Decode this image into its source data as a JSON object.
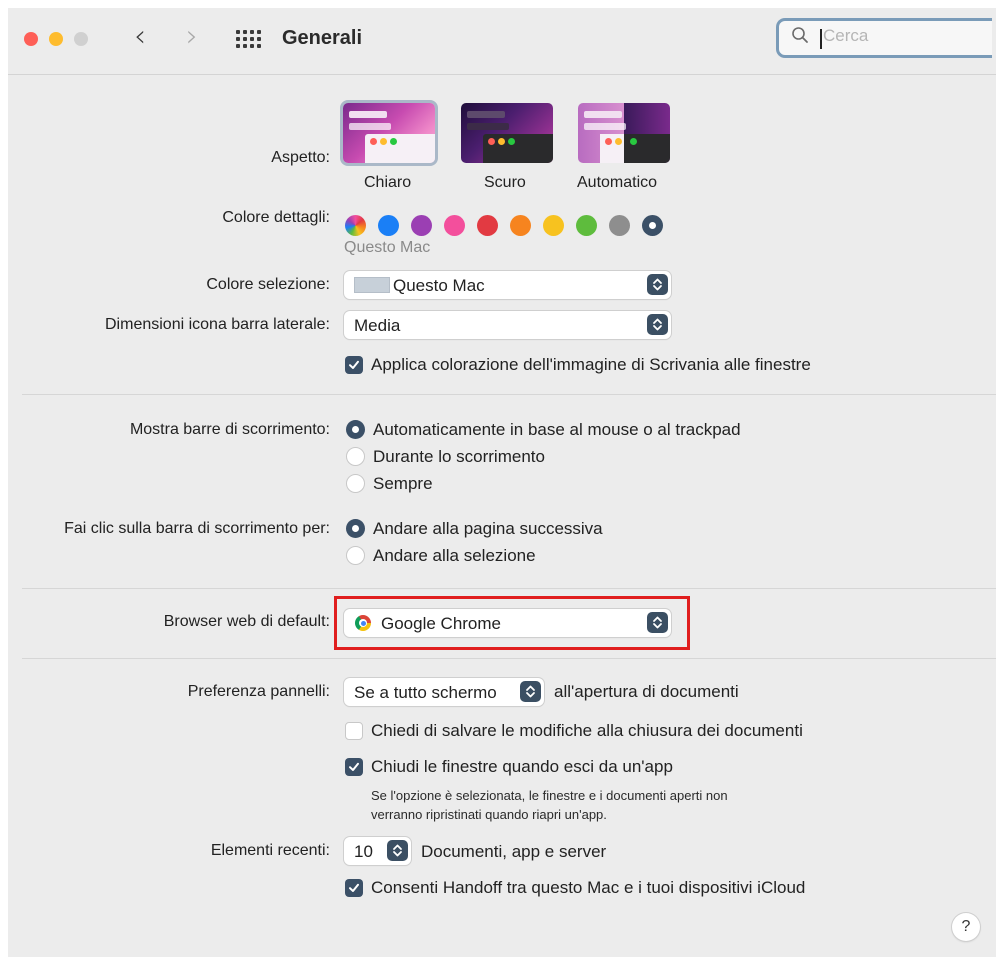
{
  "window": {
    "title": "Generali"
  },
  "search": {
    "placeholder": "Cerca"
  },
  "appearance": {
    "label": "Aspetto:",
    "options": [
      {
        "label": "Chiaro"
      },
      {
        "label": "Scuro"
      },
      {
        "label": "Automatico"
      }
    ]
  },
  "accent": {
    "label": "Colore dettagli:",
    "colors": [
      "multicolor",
      "#1a7ff6",
      "#9b3fb3",
      "#f34f9c",
      "#e23a42",
      "#f6841f",
      "#f7c21f",
      "#5ebc3d",
      "#8e8e8e",
      "#3b5067"
    ],
    "selected_caption": "Questo Mac"
  },
  "highlight_color": {
    "label": "Colore selezione:",
    "value": "Questo Mac"
  },
  "sidebar_icon_size": {
    "label": "Dimensioni icona barra laterale:",
    "value": "Media"
  },
  "wallpaper_tinting": {
    "label": "Applica colorazione dell'immagine di Scrivania alle finestre",
    "checked": true
  },
  "show_scroll_bars": {
    "label": "Mostra barre di scorrimento:",
    "options": [
      {
        "label": "Automaticamente in base al mouse o al trackpad",
        "selected": true
      },
      {
        "label": "Durante lo scorrimento",
        "selected": false
      },
      {
        "label": "Sempre",
        "selected": false
      }
    ]
  },
  "click_scroll_bar": {
    "label": "Fai clic sulla barra di scorrimento per:",
    "options": [
      {
        "label": "Andare alla pagina successiva",
        "selected": true
      },
      {
        "label": "Andare alla selezione",
        "selected": false
      }
    ]
  },
  "default_browser": {
    "label": "Browser web di default:",
    "value": "Google Chrome",
    "icon": "chrome-icon"
  },
  "tab_preference": {
    "label": "Preferenza pannelli:",
    "value": "Se a tutto schermo",
    "suffix": "all'apertura di documenti"
  },
  "ask_keep_changes": {
    "label": "Chiedi di salvare le modifiche alla chiusura dei documenti",
    "checked": false
  },
  "close_windows": {
    "label": "Chiudi le finestre quando esci da un'app",
    "checked": true,
    "note_line1": "Se l'opzione è selezionata, le finestre e i documenti aperti non",
    "note_line2": "verranno ripristinati quando riapri un'app."
  },
  "recent_items": {
    "label": "Elementi recenti:",
    "value": "10",
    "suffix": "Documenti, app e server"
  },
  "handoff": {
    "label": "Consenti Handoff tra questo Mac e i tuoi dispositivi iCloud",
    "checked": true
  },
  "help": {
    "label": "?"
  },
  "colors": {
    "close": "#fe5f57",
    "minimize": "#febc2e",
    "zoom_disabled": "#d0d0d0",
    "control_accent": "#3b5067",
    "annotation": "#e01e1e"
  }
}
